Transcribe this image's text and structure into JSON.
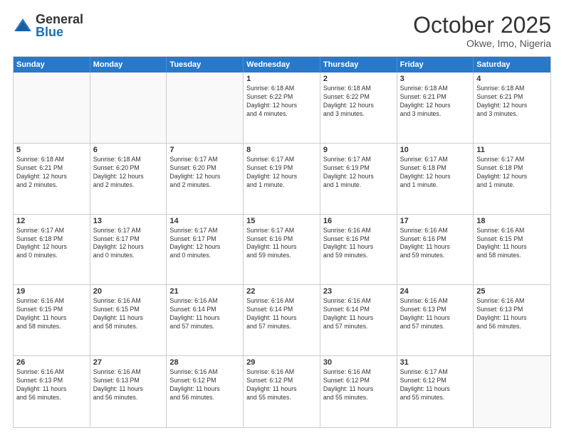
{
  "logo": {
    "general": "General",
    "blue": "Blue"
  },
  "title": "October 2025",
  "location": "Okwe, Imo, Nigeria",
  "days": [
    "Sunday",
    "Monday",
    "Tuesday",
    "Wednesday",
    "Thursday",
    "Friday",
    "Saturday"
  ],
  "weeks": [
    [
      {
        "num": "",
        "info": ""
      },
      {
        "num": "",
        "info": ""
      },
      {
        "num": "",
        "info": ""
      },
      {
        "num": "1",
        "info": "Sunrise: 6:18 AM\nSunset: 6:22 PM\nDaylight: 12 hours\nand 4 minutes."
      },
      {
        "num": "2",
        "info": "Sunrise: 6:18 AM\nSunset: 6:22 PM\nDaylight: 12 hours\nand 3 minutes."
      },
      {
        "num": "3",
        "info": "Sunrise: 6:18 AM\nSunset: 6:21 PM\nDaylight: 12 hours\nand 3 minutes."
      },
      {
        "num": "4",
        "info": "Sunrise: 6:18 AM\nSunset: 6:21 PM\nDaylight: 12 hours\nand 3 minutes."
      }
    ],
    [
      {
        "num": "5",
        "info": "Sunrise: 6:18 AM\nSunset: 6:21 PM\nDaylight: 12 hours\nand 2 minutes."
      },
      {
        "num": "6",
        "info": "Sunrise: 6:18 AM\nSunset: 6:20 PM\nDaylight: 12 hours\nand 2 minutes."
      },
      {
        "num": "7",
        "info": "Sunrise: 6:17 AM\nSunset: 6:20 PM\nDaylight: 12 hours\nand 2 minutes."
      },
      {
        "num": "8",
        "info": "Sunrise: 6:17 AM\nSunset: 6:19 PM\nDaylight: 12 hours\nand 1 minute."
      },
      {
        "num": "9",
        "info": "Sunrise: 6:17 AM\nSunset: 6:19 PM\nDaylight: 12 hours\nand 1 minute."
      },
      {
        "num": "10",
        "info": "Sunrise: 6:17 AM\nSunset: 6:18 PM\nDaylight: 12 hours\nand 1 minute."
      },
      {
        "num": "11",
        "info": "Sunrise: 6:17 AM\nSunset: 6:18 PM\nDaylight: 12 hours\nand 1 minute."
      }
    ],
    [
      {
        "num": "12",
        "info": "Sunrise: 6:17 AM\nSunset: 6:18 PM\nDaylight: 12 hours\nand 0 minutes."
      },
      {
        "num": "13",
        "info": "Sunrise: 6:17 AM\nSunset: 6:17 PM\nDaylight: 12 hours\nand 0 minutes."
      },
      {
        "num": "14",
        "info": "Sunrise: 6:17 AM\nSunset: 6:17 PM\nDaylight: 12 hours\nand 0 minutes."
      },
      {
        "num": "15",
        "info": "Sunrise: 6:17 AM\nSunset: 6:16 PM\nDaylight: 11 hours\nand 59 minutes."
      },
      {
        "num": "16",
        "info": "Sunrise: 6:16 AM\nSunset: 6:16 PM\nDaylight: 11 hours\nand 59 minutes."
      },
      {
        "num": "17",
        "info": "Sunrise: 6:16 AM\nSunset: 6:16 PM\nDaylight: 11 hours\nand 59 minutes."
      },
      {
        "num": "18",
        "info": "Sunrise: 6:16 AM\nSunset: 6:15 PM\nDaylight: 11 hours\nand 58 minutes."
      }
    ],
    [
      {
        "num": "19",
        "info": "Sunrise: 6:16 AM\nSunset: 6:15 PM\nDaylight: 11 hours\nand 58 minutes."
      },
      {
        "num": "20",
        "info": "Sunrise: 6:16 AM\nSunset: 6:15 PM\nDaylight: 11 hours\nand 58 minutes."
      },
      {
        "num": "21",
        "info": "Sunrise: 6:16 AM\nSunset: 6:14 PM\nDaylight: 11 hours\nand 57 minutes."
      },
      {
        "num": "22",
        "info": "Sunrise: 6:16 AM\nSunset: 6:14 PM\nDaylight: 11 hours\nand 57 minutes."
      },
      {
        "num": "23",
        "info": "Sunrise: 6:16 AM\nSunset: 6:14 PM\nDaylight: 11 hours\nand 57 minutes."
      },
      {
        "num": "24",
        "info": "Sunrise: 6:16 AM\nSunset: 6:13 PM\nDaylight: 11 hours\nand 57 minutes."
      },
      {
        "num": "25",
        "info": "Sunrise: 6:16 AM\nSunset: 6:13 PM\nDaylight: 11 hours\nand 56 minutes."
      }
    ],
    [
      {
        "num": "26",
        "info": "Sunrise: 6:16 AM\nSunset: 6:13 PM\nDaylight: 11 hours\nand 56 minutes."
      },
      {
        "num": "27",
        "info": "Sunrise: 6:16 AM\nSunset: 6:13 PM\nDaylight: 11 hours\nand 56 minutes."
      },
      {
        "num": "28",
        "info": "Sunrise: 6:16 AM\nSunset: 6:12 PM\nDaylight: 11 hours\nand 56 minutes."
      },
      {
        "num": "29",
        "info": "Sunrise: 6:16 AM\nSunset: 6:12 PM\nDaylight: 11 hours\nand 55 minutes."
      },
      {
        "num": "30",
        "info": "Sunrise: 6:16 AM\nSunset: 6:12 PM\nDaylight: 11 hours\nand 55 minutes."
      },
      {
        "num": "31",
        "info": "Sunrise: 6:17 AM\nSunset: 6:12 PM\nDaylight: 11 hours\nand 55 minutes."
      },
      {
        "num": "",
        "info": ""
      }
    ]
  ]
}
